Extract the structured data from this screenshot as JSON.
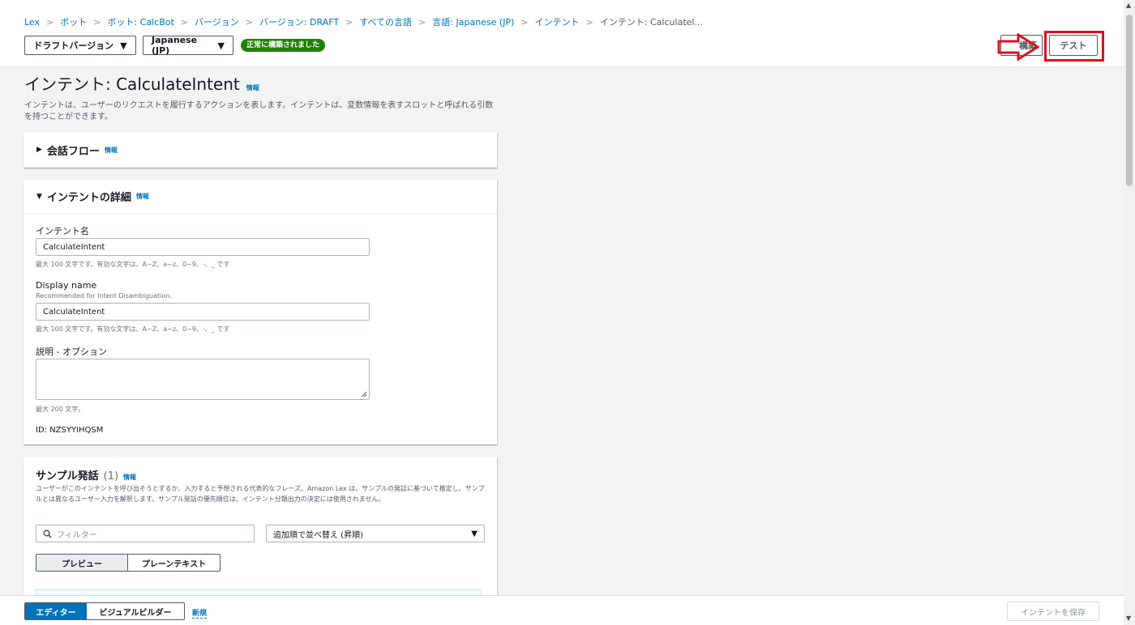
{
  "breadcrumb": [
    {
      "label": "Lex"
    },
    {
      "label": "ボット"
    },
    {
      "label": "ボット: CalcBot"
    },
    {
      "label": "バージョン"
    },
    {
      "label": "バージョン: DRAFT"
    },
    {
      "label": "すべての言語"
    },
    {
      "label": "言語: Japanese (JP)"
    },
    {
      "label": "インテント"
    },
    {
      "label": "インテント: Calculatel..."
    }
  ],
  "header": {
    "version_label": "ドラフトバージョン",
    "language_label": "Japanese (JP)",
    "status_badge": "正常に構築されました",
    "build_label": "構築",
    "test_label": "テスト"
  },
  "page": {
    "title": "インテント: CalculateIntent",
    "info": "情報",
    "description": "インテントは、ユーザーのリクエストを履行するアクションを表します。インテントは、変数情報を表すスロットと呼ばれる引数を持つことができます。"
  },
  "flow_card": {
    "title": "会話フロー",
    "info": "情報"
  },
  "detail_card": {
    "title": "インテントの詳細",
    "info": "情報",
    "name_label": "インテント名",
    "name_value": "CalculateIntent",
    "name_hint": "最大 100 文字です。有効な文字は、A~Z、a~z、0~9、-、_ です",
    "display_label": "Display name",
    "display_sub": "Recommended for Intent Disambiguation.",
    "display_value": "CalculateIntent",
    "display_hint": "最大 100 文字です。有効な文字は、A~Z、a~z、0~9、-、_ です",
    "desc_label": "説明 - オプション",
    "desc_hint": "最大 200 文字。",
    "id_text": "ID: NZSYYIHQSM"
  },
  "sample_card": {
    "title": "サンプル発話",
    "count": "(1)",
    "info": "情報",
    "description": "ユーザーがこのインテントを呼び出そうとするか、入力すると予想される代表的なフレーズ。Amazon Lex は、サンプルの発話に基づいて推定し、サンプルとは異なるユーザー入力を解釈します。サンプル発話の優先順位は、インテント分類出力の決定には使用されません。",
    "filter_placeholder": "フィルター",
    "sort_label": "追加順で並べ替え (昇順)",
    "tab_preview": "プレビュー",
    "tab_plain": "プレーンテキスト"
  },
  "bottom": {
    "editor_label": "エディター",
    "visual_label": "ビジュアルビルダー",
    "new_label": "新規",
    "save_label": "インテントを保存"
  },
  "colors": {
    "link": "#0073bb",
    "success": "#1d8102",
    "highlight": "#e0101e"
  }
}
